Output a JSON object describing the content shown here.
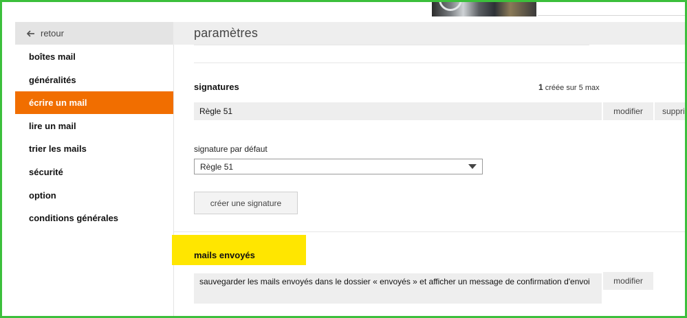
{
  "header": {
    "back_label": "retour",
    "page_title": "paramètres"
  },
  "sidebar": {
    "items": [
      {
        "label": "boîtes mail",
        "active": false
      },
      {
        "label": "généralités",
        "active": false
      },
      {
        "label": "écrire un mail",
        "active": true
      },
      {
        "label": "lire un mail",
        "active": false
      },
      {
        "label": "trier les mails",
        "active": false
      },
      {
        "label": "sécurité",
        "active": false
      },
      {
        "label": "option",
        "active": false
      },
      {
        "label": "conditions générales",
        "active": false
      }
    ]
  },
  "signatures": {
    "title": "signatures",
    "count_number": "1",
    "count_text": " créée sur 5 max",
    "items": [
      {
        "name": "Règle 51",
        "edit_label": "modifier",
        "delete_label": "suppri"
      }
    ],
    "default_label": "signature par défaut",
    "default_value": "Règle 51",
    "create_label": "créer une signature"
  },
  "sent_mails": {
    "title": "mails envoyés",
    "description": "sauvegarder les mails envoyés dans le dossier « envoyés » et afficher un message de confirmation d'envoi",
    "edit_label": "modifier"
  },
  "colors": {
    "accent": "#f16e00",
    "highlight": "#ffe600",
    "frame": "#3cbf3c"
  }
}
